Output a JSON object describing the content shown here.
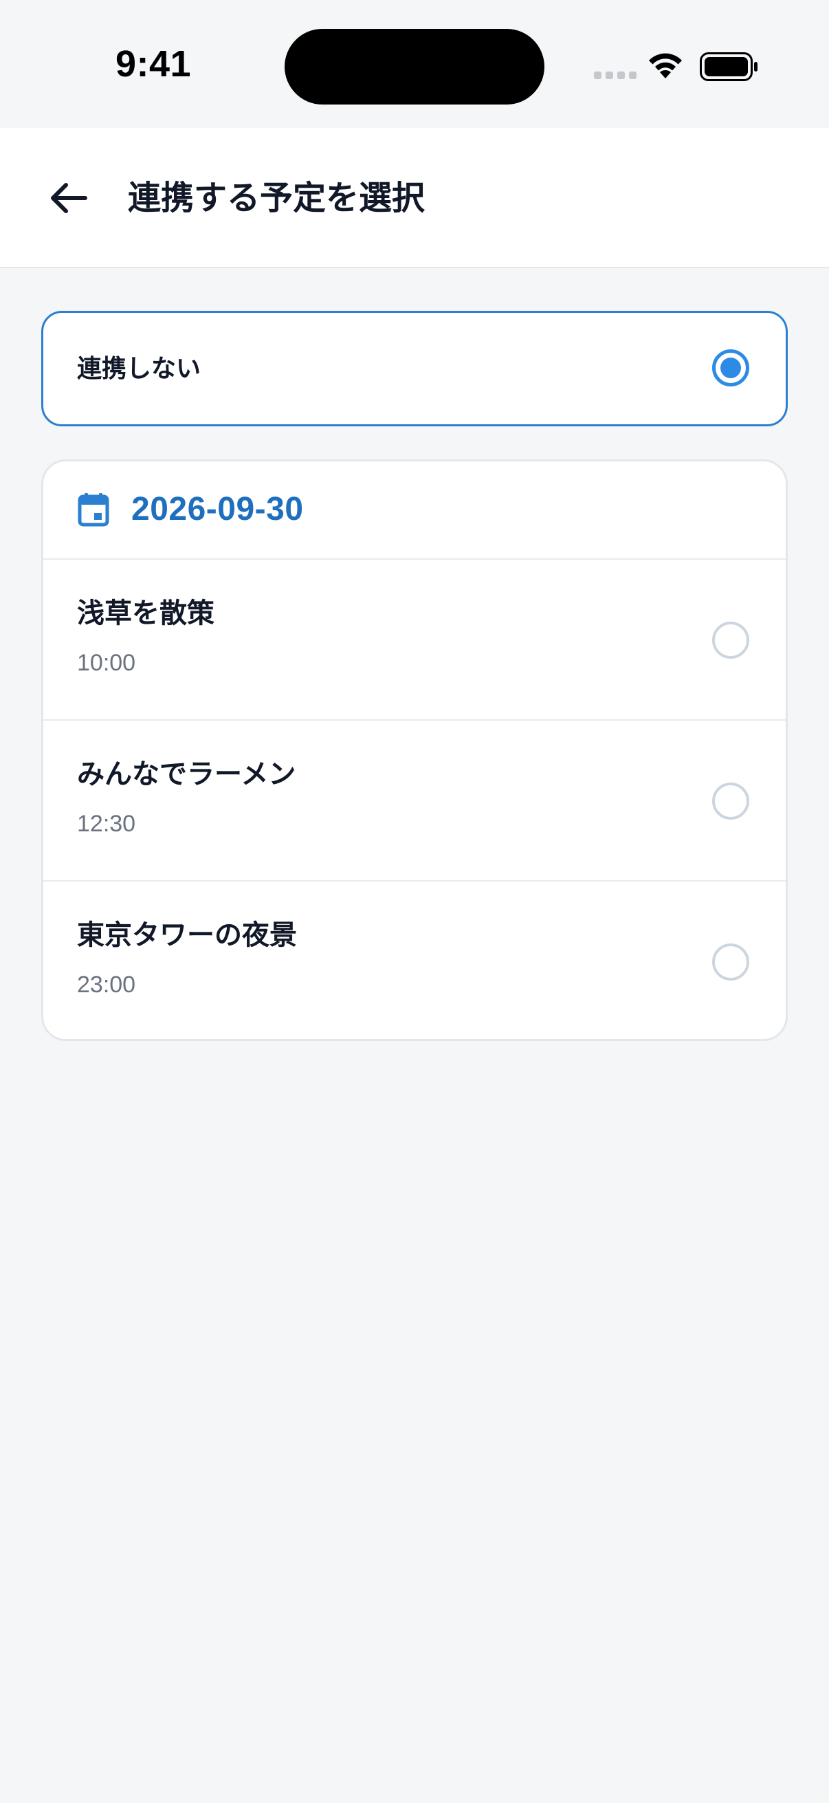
{
  "status_bar": {
    "time": "9:41"
  },
  "header": {
    "title": "連携する予定を選択",
    "back_icon": "arrow-left-icon"
  },
  "options": {
    "none_label": "連携しない",
    "selected": "none"
  },
  "events_card": {
    "date": "2026-09-30",
    "date_icon": "calendar-icon",
    "accent_color": "#1f6fbf",
    "events": [
      {
        "title": "浅草を散策",
        "time": "10:00"
      },
      {
        "title": "みんなでラーメン",
        "time": "12:30"
      },
      {
        "title": "東京タワーの夜景",
        "time": "23:00"
      }
    ]
  },
  "colors": {
    "background": "#f4f6f8",
    "selected_border": "#2b7fd0",
    "radio_selected": "#2d8be6",
    "radio_unselected": "#cdd5df"
  }
}
